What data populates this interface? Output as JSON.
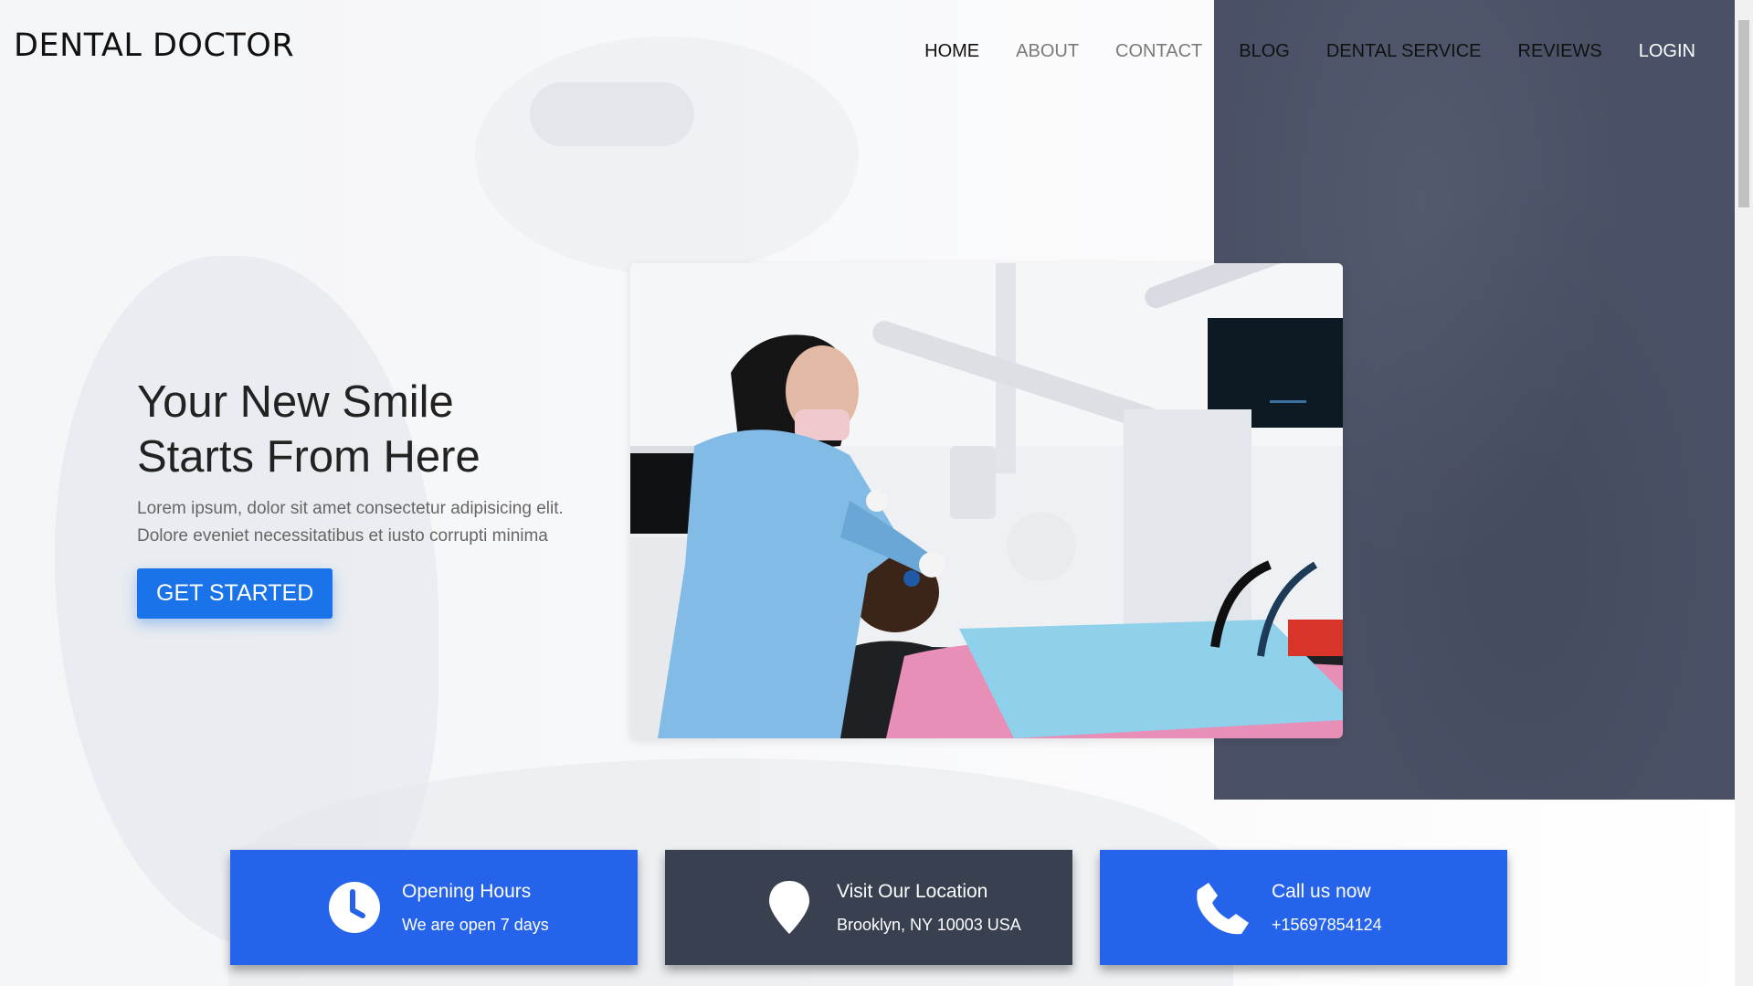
{
  "brand": {
    "logo_text": "DENTAL DOCTOR"
  },
  "nav": {
    "items": [
      {
        "label": "HOME"
      },
      {
        "label": "ABOUT"
      },
      {
        "label": "CONTACT"
      },
      {
        "label": "BLOG"
      },
      {
        "label": "DENTAL SERVICE"
      },
      {
        "label": "REVIEWS"
      },
      {
        "label": "LOGIN"
      }
    ]
  },
  "hero": {
    "title_line1": "Your New Smile",
    "title_line2": "Starts From Here",
    "subtitle_line1": "Lorem ipsum, dolor sit amet consectetur adipisicing elit.",
    "subtitle_line2": "Dolore eveniet necessitatibus et iusto corrupti minima",
    "cta_label": "GET STARTED",
    "image_icon": "dentist-photo"
  },
  "info_cards": [
    {
      "icon": "clock-icon",
      "title": "Opening Hours",
      "text": "We are open 7 days"
    },
    {
      "icon": "location-pin-icon",
      "title": "Visit Our Location",
      "text": "Brooklyn, NY 10003 USA"
    },
    {
      "icon": "phone-icon",
      "title": "Call us now",
      "text": "+15697854124"
    }
  ],
  "colors": {
    "accent_blue": "#2563eb",
    "button_blue": "#1a73e8",
    "dark_card": "#394050",
    "dark_panel": "#4a5166"
  }
}
